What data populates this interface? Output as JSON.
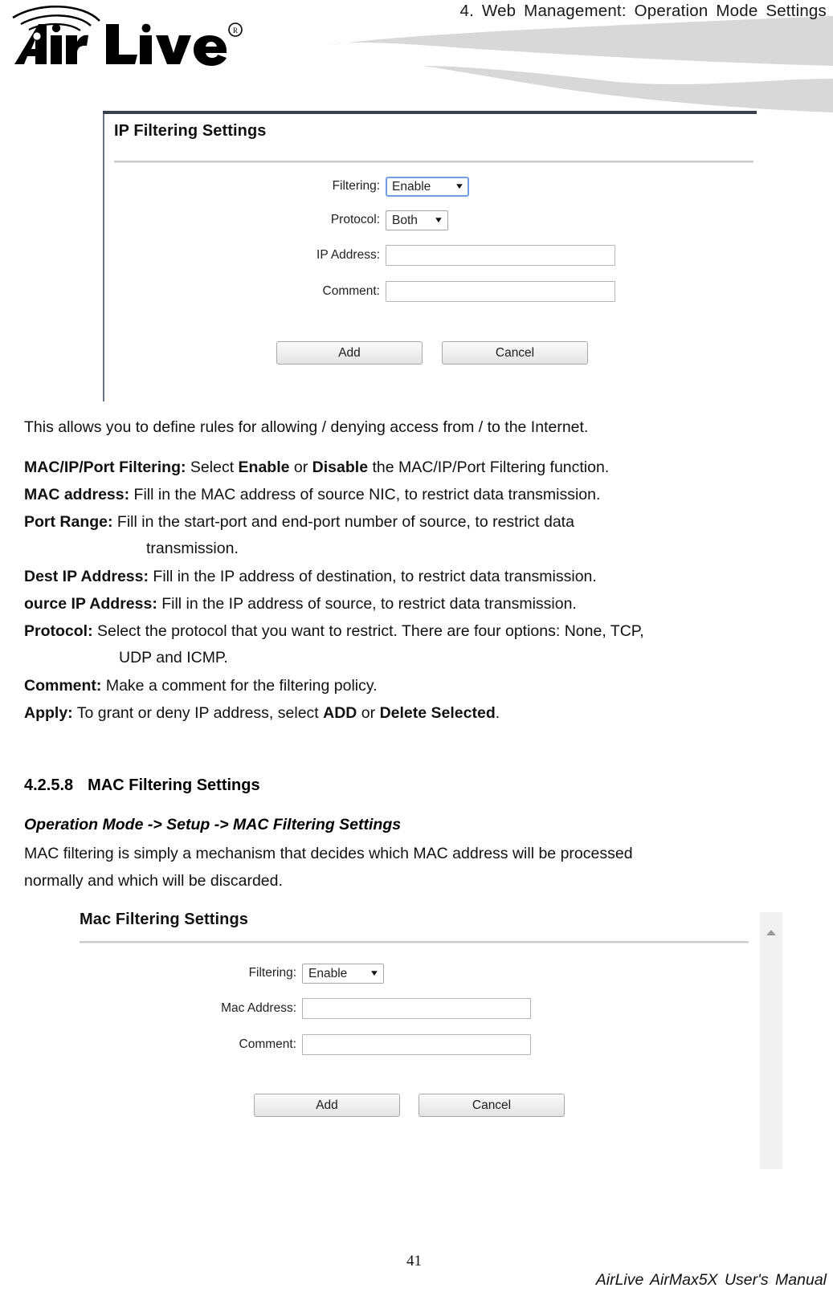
{
  "header": {
    "title": "4. Web Management: Operation Mode Settings",
    "logo_text": "Air Live",
    "logo_registered": "®"
  },
  "ip_panel": {
    "title": "IP Filtering Settings",
    "rows": [
      {
        "label": "Filtering:",
        "control": "select",
        "value": "Enable",
        "caret": "▼",
        "focused": true
      },
      {
        "label": "Protocol:",
        "control": "select",
        "value": "Both",
        "caret": "▼",
        "focused": false
      },
      {
        "label": "IP Address:",
        "control": "input",
        "value": "",
        "placeholder": ""
      },
      {
        "label": "Comment:",
        "control": "input",
        "value": "",
        "placeholder": ""
      }
    ],
    "buttons": {
      "add": "Add",
      "cancel": "Cancel"
    }
  },
  "intro_paragraph": "This allows you to define rules for allowing / denying access from / to the Internet.",
  "definitions": [
    {
      "term": "MAC/IP/Port Filtering:",
      "parts": [
        {
          "text": " Select ",
          "bold": false
        },
        {
          "text": "Enable",
          "bold": true
        },
        {
          "text": " or ",
          "bold": false
        },
        {
          "text": "Disable",
          "bold": true
        },
        {
          "text": " the MAC/IP/Port Filtering function.",
          "bold": false
        }
      ]
    },
    {
      "term": "MAC address:",
      "parts": [
        {
          "text": " Fill in the MAC address of source NIC, to restrict data transmission.",
          "bold": false
        }
      ]
    },
    {
      "term": "Port Range:",
      "parts": [
        {
          "text": " Fill in the start-port and end-port number of source, to restrict data",
          "bold": false
        }
      ],
      "continuation": "transmission."
    },
    {
      "term": "Dest IP Address:",
      "parts": [
        {
          "text": " Fill in the IP address of destination, to restrict data transmission.",
          "bold": false
        }
      ]
    },
    {
      "term": "ource IP Address:",
      "parts": [
        {
          "text": " Fill in the IP address of source, to restrict data transmission.",
          "bold": false
        }
      ]
    },
    {
      "term": "Protocol:",
      "parts": [
        {
          "text": " Select the protocol that you want to restrict. There are four options: None, TCP,",
          "bold": false
        }
      ],
      "continuation": "UDP and ICMP."
    },
    {
      "term": "Comment:",
      "parts": [
        {
          "text": " Make a comment for the filtering policy.",
          "bold": false
        }
      ]
    },
    {
      "term": "Apply:",
      "parts": [
        {
          "text": " To grant or deny IP address, select ",
          "bold": false
        },
        {
          "text": "ADD",
          "bold": true
        },
        {
          "text": " or ",
          "bold": false
        },
        {
          "text": "Delete Selected",
          "bold": true
        },
        {
          "text": ".",
          "bold": false
        }
      ]
    }
  ],
  "section": {
    "number": "4.2.5.8",
    "title": "MAC Filtering Settings",
    "breadcrumb": "Operation Mode -> Setup -> MAC Filtering Settings",
    "description_line1": "MAC filtering is simply a mechanism that decides which MAC address will be processed",
    "description_line2": "normally and which will be discarded."
  },
  "mac_panel": {
    "title": "Mac Filtering Settings",
    "rows": [
      {
        "label": "Filtering:",
        "control": "select",
        "value": "Enable",
        "caret": "▼",
        "focused": false
      },
      {
        "label": "Mac Address:",
        "control": "input",
        "value": "",
        "placeholder": ""
      },
      {
        "label": "Comment:",
        "control": "input",
        "value": "",
        "placeholder": ""
      }
    ],
    "buttons": {
      "add": "Add",
      "cancel": "Cancel"
    },
    "scrollbar": {
      "up_arrow": "▲"
    }
  },
  "footer": {
    "page_number": "41",
    "manual_title": "AirLive AirMax5X User's Manual"
  }
}
